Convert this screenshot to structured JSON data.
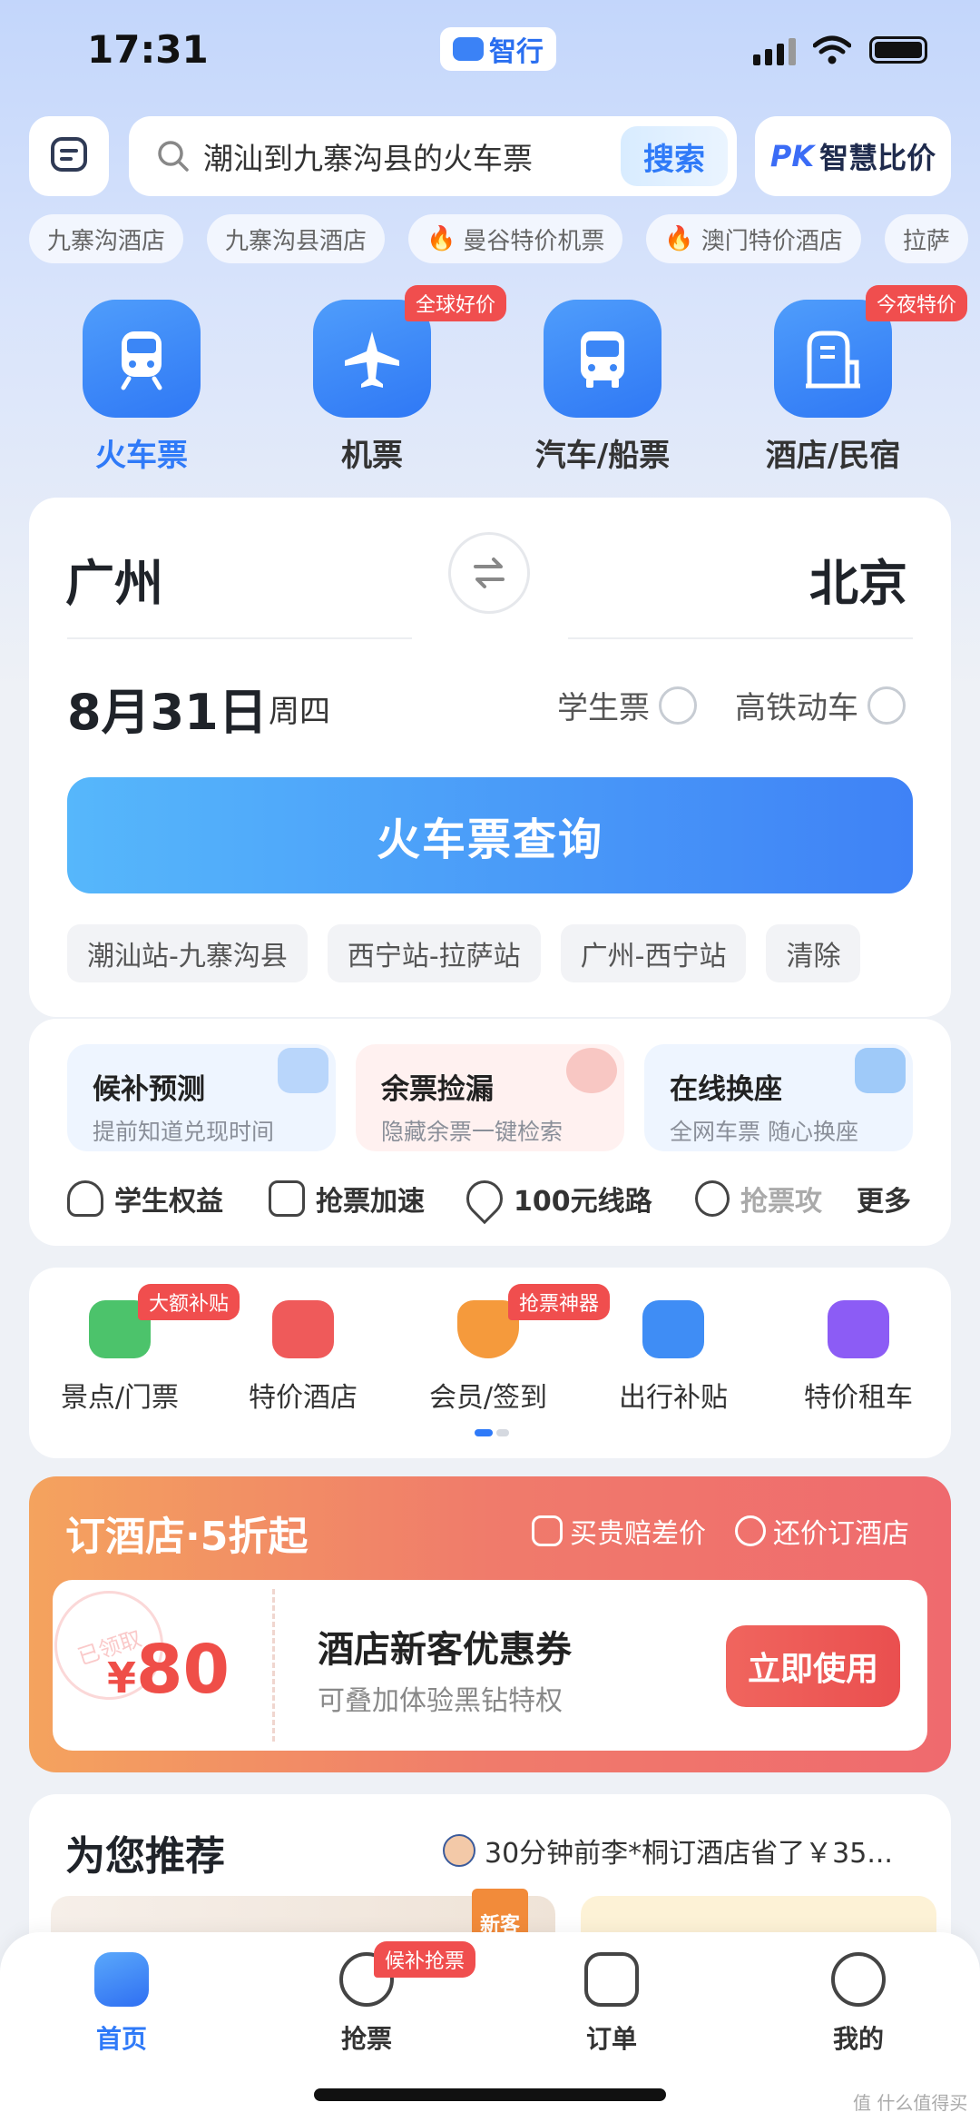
{
  "status_bar": {
    "time": "17:31",
    "app_name": "智行"
  },
  "search": {
    "query": "潮汕到九寨沟县的火车票",
    "button": "搜索",
    "pk_prefix": "PK",
    "pk_label": "智慧比价"
  },
  "quick_tags": [
    {
      "label": "九寨沟酒店",
      "hot": false
    },
    {
      "label": "九寨沟县酒店",
      "hot": false
    },
    {
      "label": "曼谷特价机票",
      "hot": true
    },
    {
      "label": "澳门特价酒店",
      "hot": true
    },
    {
      "label": "拉萨",
      "hot": false
    }
  ],
  "categories": [
    {
      "label": "火车票",
      "icon": "train-icon",
      "active": true,
      "badge": ""
    },
    {
      "label": "机票",
      "icon": "plane-icon",
      "active": false,
      "badge": "全球好价"
    },
    {
      "label": "汽车/船票",
      "icon": "bus-icon",
      "active": false,
      "badge": ""
    },
    {
      "label": "酒店/民宿",
      "icon": "hotel-icon",
      "active": false,
      "badge": "今夜特价"
    }
  ],
  "ticket": {
    "from": "广州",
    "to": "北京",
    "date": "8月31日",
    "weekday": "周四",
    "student_label": "学生票",
    "highspeed_label": "高铁动车",
    "query_button": "火车票查询",
    "history": [
      "潮汕站-九寨沟县",
      "西宁站-拉萨站",
      "广州-西宁站",
      "清除"
    ]
  },
  "services": [
    {
      "title": "候补预测",
      "subtitle": "提前知道兑现时间",
      "bg": "#eef5ff",
      "deco": "#b9d6fb"
    },
    {
      "title": "余票捡漏",
      "subtitle": "隐藏余票一键检索",
      "bg": "#fff1f0",
      "deco": "#f8c7c3"
    },
    {
      "title": "在线换座",
      "subtitle": "全网车票 随心换座",
      "bg": "#eef5ff",
      "deco": "#9fcaf9"
    }
  ],
  "mini_links": [
    "学生权益",
    "抢票加速",
    "100元线路",
    "抢票攻",
    "更多"
  ],
  "grid": [
    {
      "label": "景点/门票",
      "icon": "scenic-icon",
      "color": "#4cc36b",
      "badge": "大额补贴"
    },
    {
      "label": "特价酒店",
      "icon": "hotel-deal-icon",
      "color": "#ef5a5a",
      "badge": ""
    },
    {
      "label": "会员/签到",
      "icon": "member-icon",
      "color": "#f59a3c",
      "badge": "抢票神器"
    },
    {
      "label": "出行补贴",
      "icon": "subsidy-icon",
      "color": "#3f8df5",
      "badge": ""
    },
    {
      "label": "特价租车",
      "icon": "car-rental-icon",
      "color": "#8c5cf5",
      "badge": ""
    }
  ],
  "promo": {
    "title": "订酒店·5折起",
    "tag1": "买贵赔差价",
    "tag2": "还价订酒店",
    "stamp": "已领取",
    "currency": "¥",
    "amount": "80",
    "coupon_title": "酒店新客优惠券",
    "coupon_sub": "可叠加体验黑钻特权",
    "button": "立即使用"
  },
  "recommend": {
    "title": "为您推荐",
    "news": "30分钟前李*桐订酒店省了￥35...",
    "new_tag": "新客"
  },
  "tabbar": [
    {
      "label": "首页",
      "icon": "home-icon",
      "active": true,
      "badge": ""
    },
    {
      "label": "抢票",
      "icon": "grab-ticket-icon",
      "active": false,
      "badge": "候补抢票"
    },
    {
      "label": "订单",
      "icon": "order-icon",
      "active": false,
      "badge": ""
    },
    {
      "label": "我的",
      "icon": "profile-icon",
      "active": false,
      "badge": ""
    }
  ],
  "watermark": "值 什么值得买"
}
